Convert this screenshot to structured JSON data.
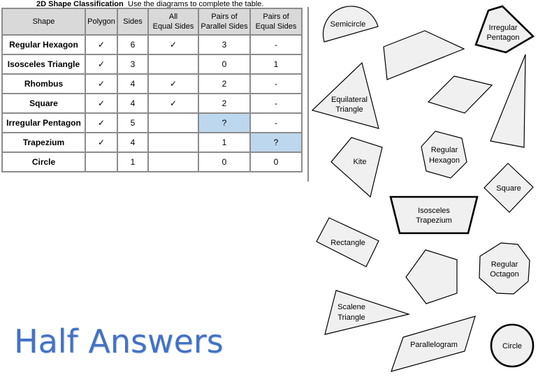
{
  "header": {
    "title": "2D Shape Classification",
    "instruction": "Use the diagrams to complete the table."
  },
  "table": {
    "columns": [
      "Shape",
      "Polygon",
      "Sides",
      "All Equal Sides",
      "Pairs of Parallel Sides",
      "Pairs of Equal Sides"
    ],
    "column_lines": [
      [
        "Shape"
      ],
      [
        "Polygon"
      ],
      [
        "Sides"
      ],
      [
        "All",
        "Equal Sides"
      ],
      [
        "Pairs of",
        "Parallel Sides"
      ],
      [
        "Pairs of",
        "Equal Sides"
      ]
    ],
    "rows": [
      {
        "shape": "Regular Hexagon",
        "polygon": "✓",
        "sides": "6",
        "all_equal": "✓",
        "parallel": "3",
        "equal_pairs": "-"
      },
      {
        "shape": "Isosceles Triangle",
        "polygon": "✓",
        "sides": "3",
        "all_equal": "",
        "parallel": "0",
        "equal_pairs": "1"
      },
      {
        "shape": "Rhombus",
        "polygon": "✓",
        "sides": "4",
        "all_equal": "✓",
        "parallel": "2",
        "equal_pairs": "-"
      },
      {
        "shape": "Square",
        "polygon": "✓",
        "sides": "4",
        "all_equal": "✓",
        "parallel": "2",
        "equal_pairs": "-"
      },
      {
        "shape": "Irregular Pentagon",
        "polygon": "✓",
        "sides": "5",
        "all_equal": "",
        "parallel": "?",
        "equal_pairs": "-"
      },
      {
        "shape": "Trapezium",
        "polygon": "✓",
        "sides": "4",
        "all_equal": "",
        "parallel": "1",
        "equal_pairs": "?"
      },
      {
        "shape": "Circle",
        "polygon": "",
        "sides": "1",
        "all_equal": "",
        "parallel": "0",
        "equal_pairs": "0"
      }
    ],
    "highlight_color": "#bdd7ee",
    "header_color": "#d9d9d9"
  },
  "diagrams": {
    "semicircle": {
      "label": [
        "Semicircle"
      ]
    },
    "irregular_pentagon": {
      "label": [
        "Irregular",
        "Pentagon"
      ]
    },
    "equilateral_triangle": {
      "label": [
        "Equilateral",
        "Triangle"
      ]
    },
    "kite": {
      "label": [
        "Kite"
      ]
    },
    "regular_hexagon": {
      "label": [
        "Regular",
        "Hexagon"
      ]
    },
    "square": {
      "label": [
        "Square"
      ]
    },
    "isosceles_trapezium": {
      "label": [
        "Isosceles",
        "Trapezium"
      ]
    },
    "rectangle": {
      "label": [
        "Rectangle"
      ]
    },
    "regular_octagon": {
      "label": [
        "Regular",
        "Octagon"
      ]
    },
    "scalene_triangle": {
      "label": [
        "Scalene",
        "Triangle"
      ]
    },
    "parallelogram": {
      "label": [
        "Parallelogram"
      ]
    },
    "circle": {
      "label": [
        "Circle"
      ]
    }
  },
  "footer": {
    "watermark": "Half Answers",
    "watermark_color": "#4472c4"
  }
}
